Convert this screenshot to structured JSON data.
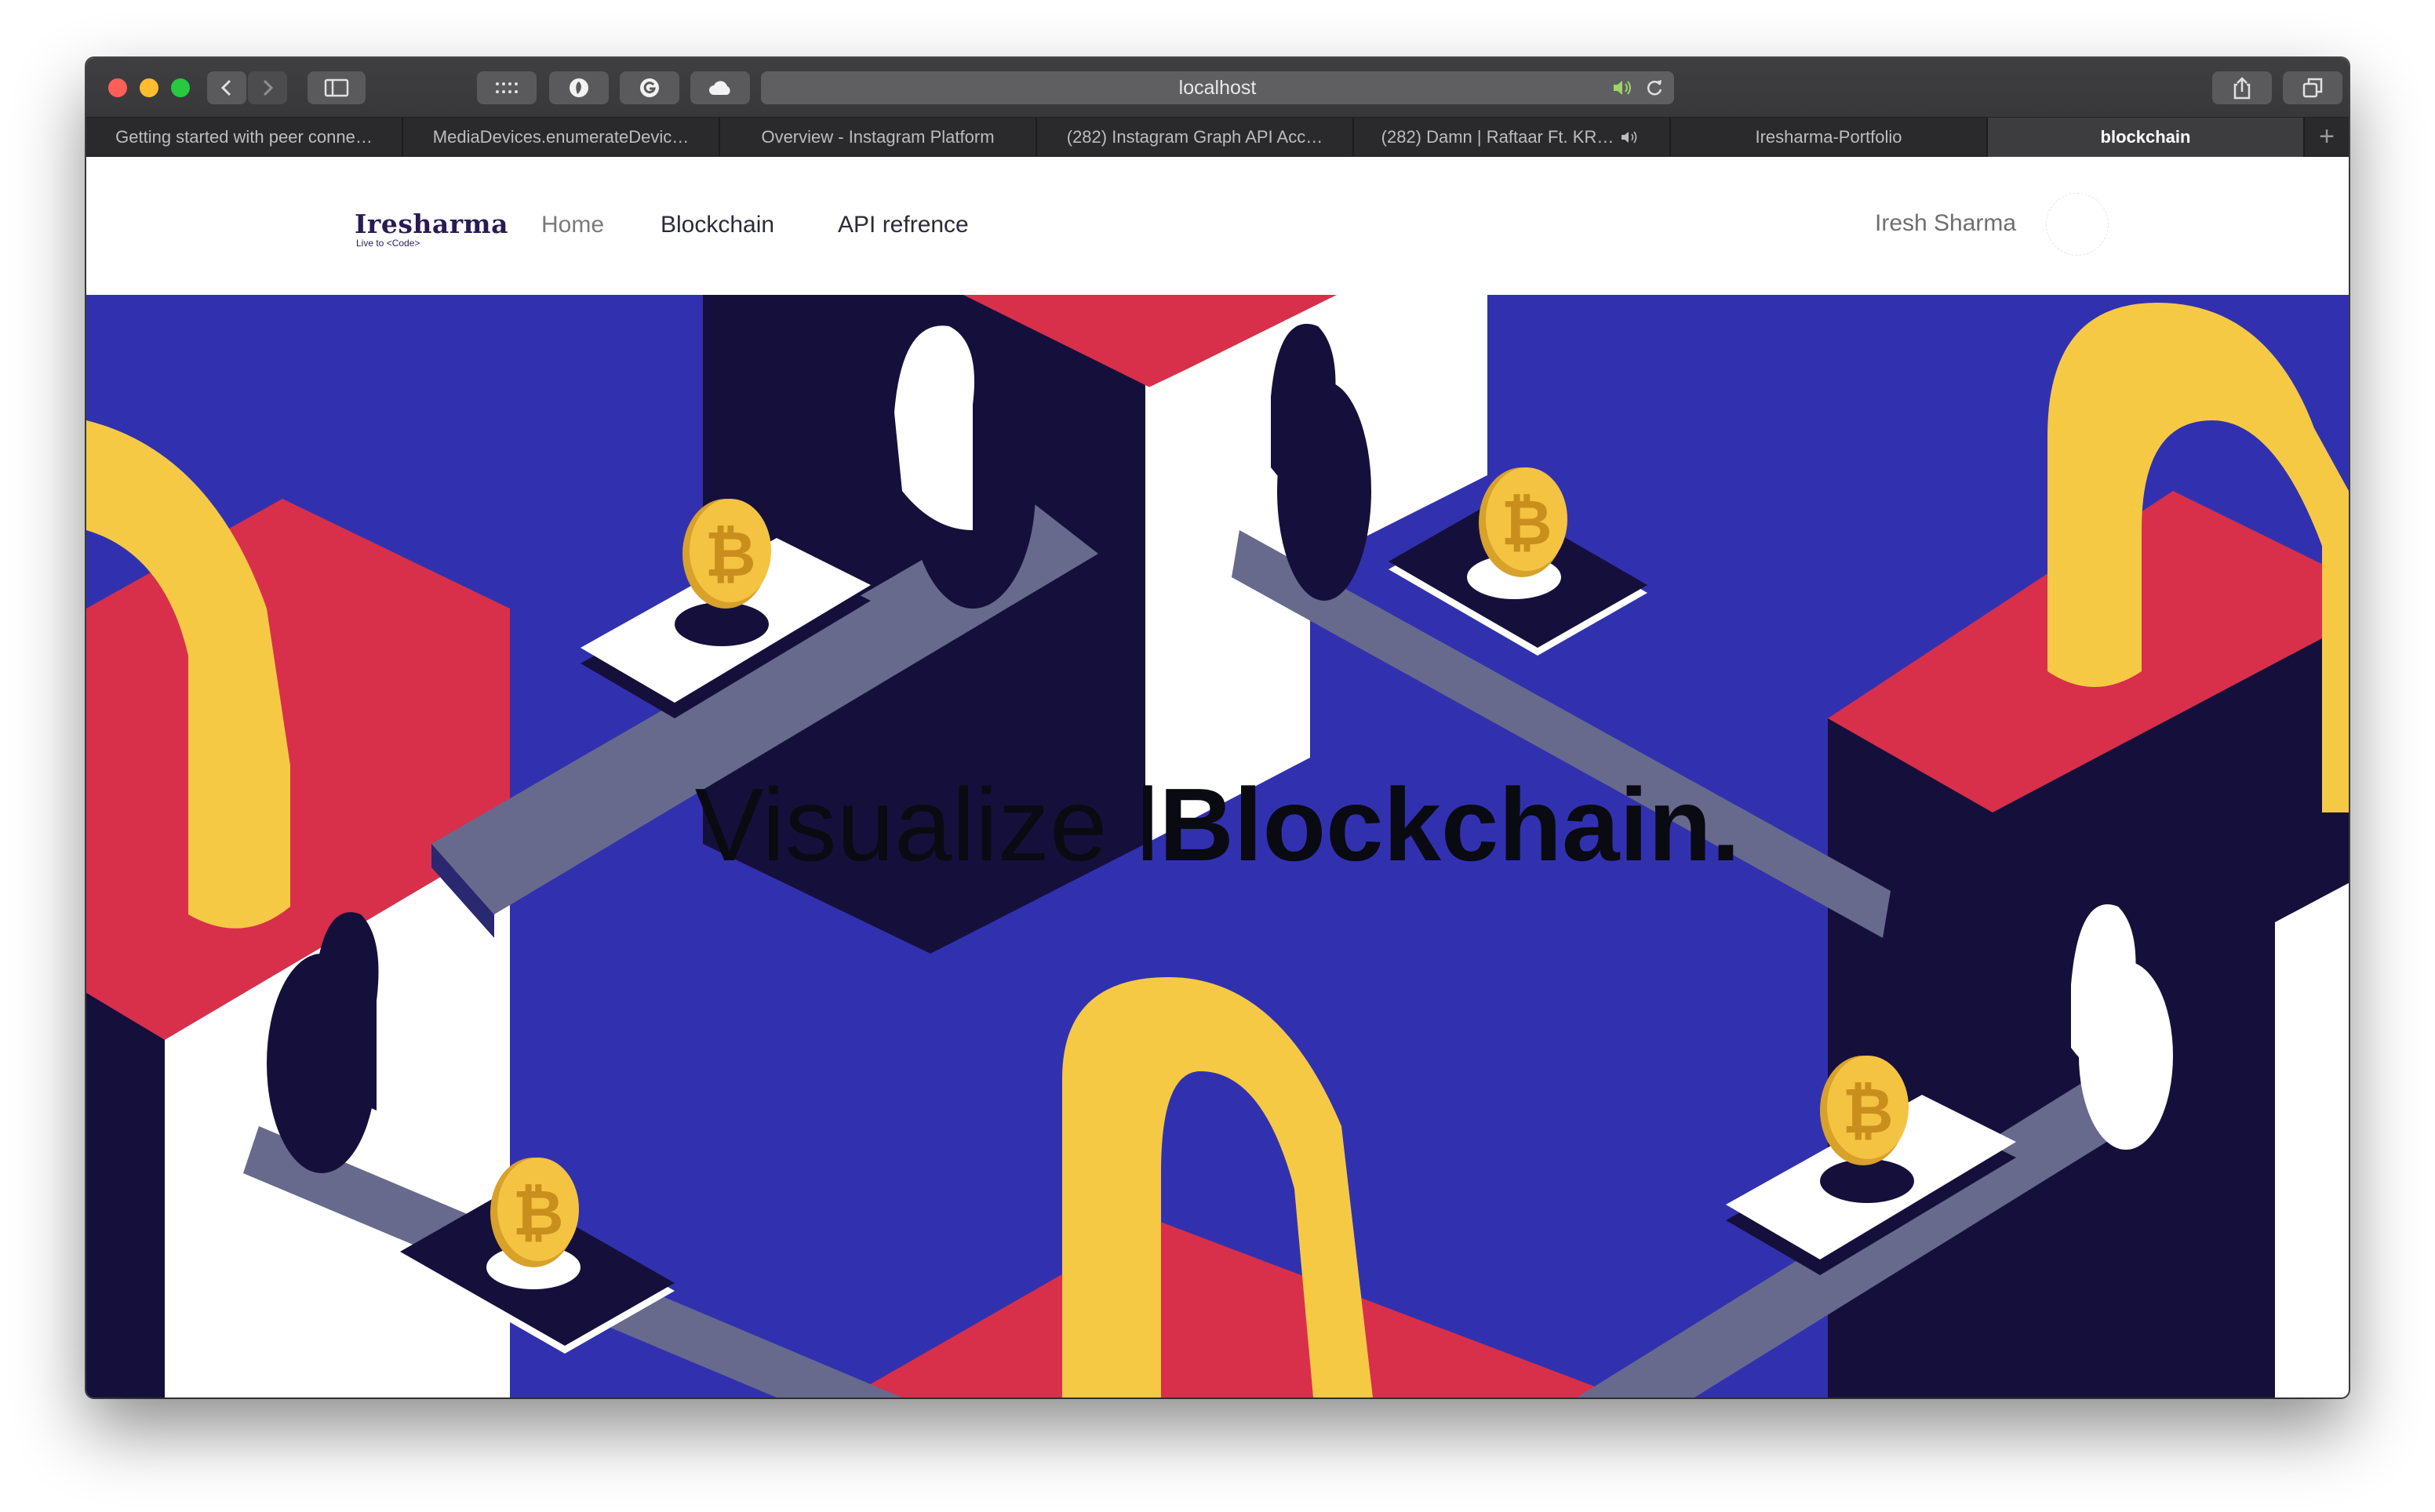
{
  "browser": {
    "url": "localhost",
    "tabs": [
      {
        "label": "Getting started with peer conne…"
      },
      {
        "label": "MediaDevices.enumerateDevic…"
      },
      {
        "label": "Overview - Instagram Platform"
      },
      {
        "label": "(282) Instagram Graph API Acc…"
      },
      {
        "label": "(282) Damn | Raftaar Ft. KR…"
      },
      {
        "label": "Iresharma-Portfolio"
      },
      {
        "label": "blockchain"
      }
    ],
    "new_tab": "+"
  },
  "site": {
    "logo_name": "Iresharma",
    "logo_tagline": "Live to <Code>",
    "nav": {
      "home": "Home",
      "blockchain": "Blockchain",
      "api": "API refrence"
    },
    "user_name": "Iresh Sharma"
  },
  "hero": {
    "headline_light": "Visualize l",
    "headline_bold": "Blockchain."
  },
  "colors": {
    "hero_blue": "#3131af",
    "navy": "#15103b",
    "red": "#d8304a",
    "yellow": "#f6c944",
    "slate": "#676a8c",
    "coin": "#f5c342"
  }
}
